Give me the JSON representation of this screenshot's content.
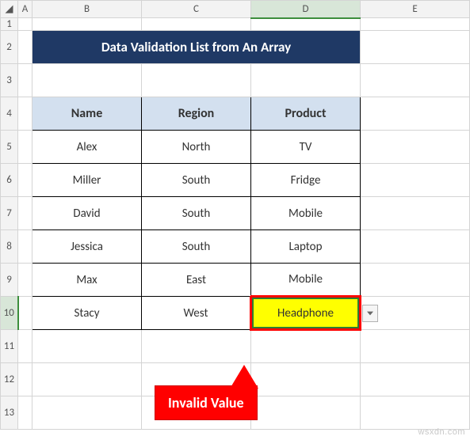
{
  "columns": {
    "corner": "◢",
    "A": "A",
    "B": "B",
    "C": "C",
    "D": "D",
    "E": "E"
  },
  "rows": {
    "r1": "1",
    "r2": "2",
    "r3": "3",
    "r4": "4",
    "r5": "5",
    "r6": "6",
    "r7": "7",
    "r8": "8",
    "r9": "9",
    "r10": "10",
    "r11": "11",
    "r12": "12",
    "r13": "13"
  },
  "title": "Data Validation List from An Array",
  "headers": {
    "name": "Name",
    "region": "Region",
    "product": "Product"
  },
  "data": [
    {
      "name": "Alex",
      "region": "North",
      "product": "TV"
    },
    {
      "name": "Miller",
      "region": "South",
      "product": "Fridge"
    },
    {
      "name": "David",
      "region": "South",
      "product": "Mobile"
    },
    {
      "name": "Jessica",
      "region": "South",
      "product": "Laptop"
    },
    {
      "name": "Max",
      "region": "East",
      "product": "Mobile"
    },
    {
      "name": "Stacy",
      "region": "West",
      "product": "Headphone"
    }
  ],
  "callout": {
    "label": "Invalid Value"
  },
  "watermark": "wsxdn.com",
  "selected_cell": "D10"
}
